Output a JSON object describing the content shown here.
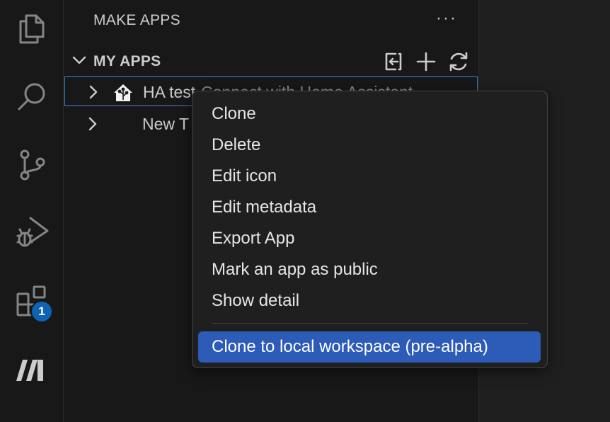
{
  "activity_bar": {
    "icons": [
      "explorer-icon",
      "search-icon",
      "source-control-icon",
      "run-debug-icon",
      "extensions-icon",
      "make-logo-icon"
    ],
    "extensions_badge": "1"
  },
  "sidebar": {
    "title": "MAKE APPS",
    "more_label": "···",
    "section": {
      "title": "MY APPS",
      "actions": [
        "import-icon",
        "add-icon",
        "refresh-icon"
      ]
    },
    "tree": [
      {
        "label": "HA test",
        "description": "Connect with Home Assistant",
        "icon": "home-assistant-icon"
      },
      {
        "label": "New T",
        "description": "",
        "icon": ""
      }
    ]
  },
  "context_menu": {
    "items": [
      {
        "label": "Clone"
      },
      {
        "label": "Delete"
      },
      {
        "label": "Edit icon"
      },
      {
        "label": "Edit metadata"
      },
      {
        "label": "Export App"
      },
      {
        "label": "Mark an app as public"
      },
      {
        "label": "Show detail"
      }
    ],
    "highlighted_item": {
      "label": "Clone to local workspace (pre-alpha)"
    }
  },
  "colors": {
    "accent": "#2c5bb8",
    "selection_border": "#3a86d4",
    "badge": "#0e63b4"
  }
}
